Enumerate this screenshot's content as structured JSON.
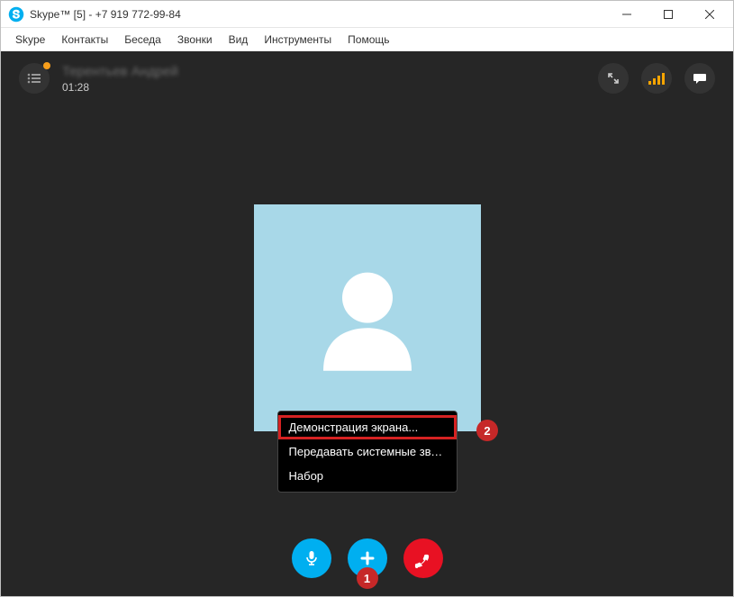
{
  "window": {
    "title": "Skype™ [5] - +7 919 772-99-84"
  },
  "menu": {
    "items": [
      "Skype",
      "Контакты",
      "Беседа",
      "Звонки",
      "Вид",
      "Инструменты",
      "Помощь"
    ]
  },
  "call": {
    "contact_name": "Терентьев Андрей",
    "duration": "01:28"
  },
  "popup": {
    "items": [
      "Демонстрация экрана...",
      "Передавать системные звуки...",
      "Набор"
    ]
  },
  "annotations": {
    "badge1": "1",
    "badge2": "2"
  },
  "icons": {
    "list": "list-icon",
    "fullscreen": "fullscreen-icon",
    "signal": "signal-icon",
    "chat": "chat-icon",
    "mic": "mic-icon",
    "plus": "plus-icon",
    "hangup": "hangup-icon"
  }
}
